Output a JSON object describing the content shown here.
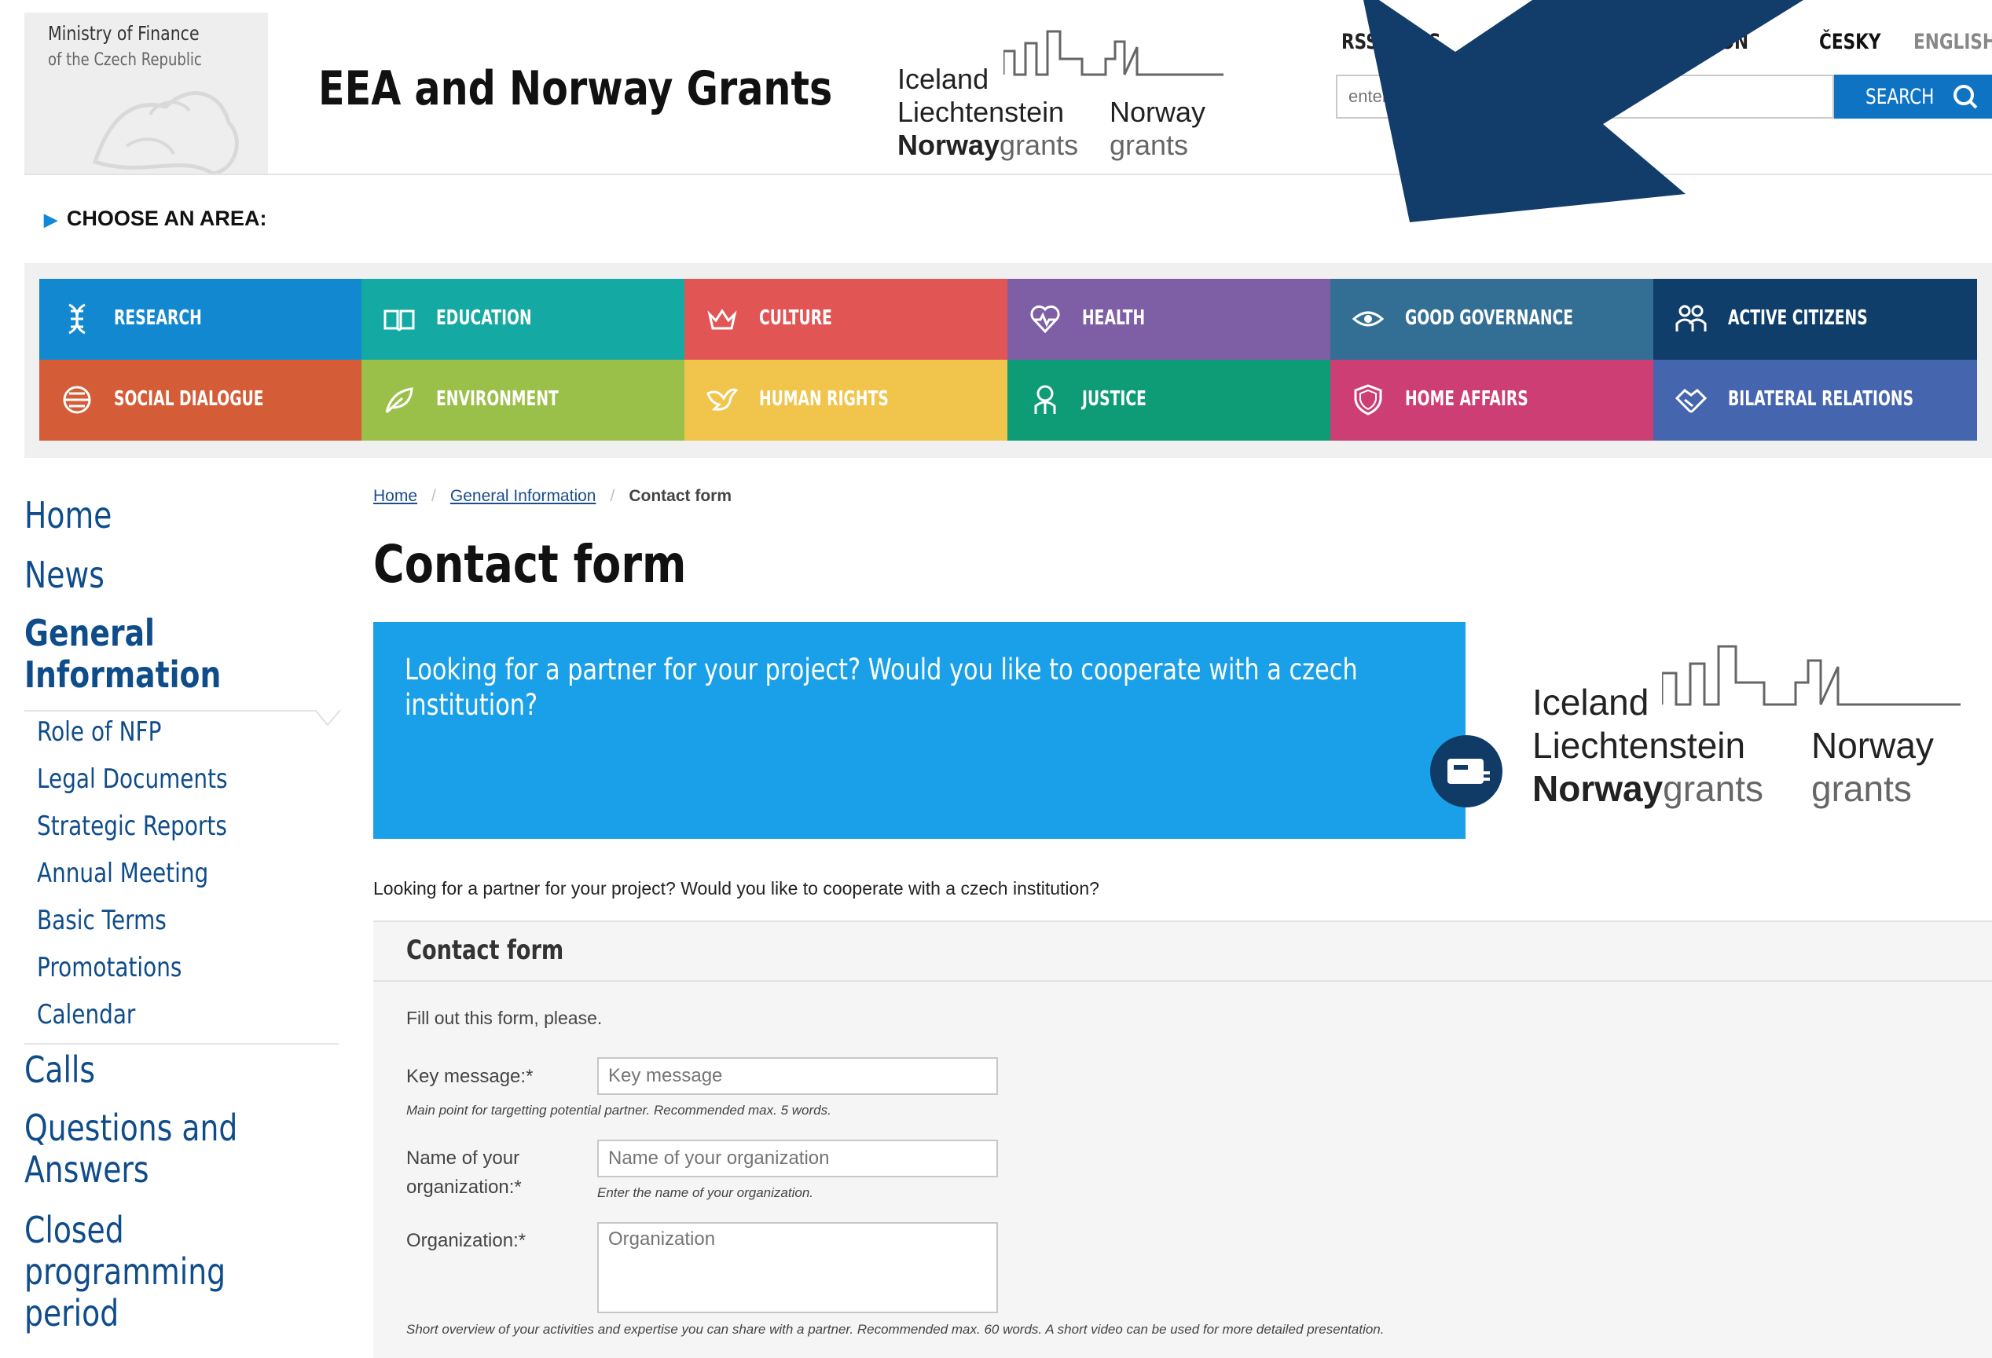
{
  "header": {
    "ministry_line1": "Ministry of Finance",
    "ministry_line2": "of the Czech Republic",
    "site_title": "EEA and Norway Grants",
    "logo_left": [
      "Iceland",
      "Liechtenstein",
      "Norway",
      "grants"
    ],
    "logo_right": [
      "Norway",
      "grants"
    ],
    "links": {
      "rss": "RSS NEWS",
      "version": "VERSION",
      "czech": "ČESKY",
      "english": "ENGLISH"
    },
    "search": {
      "placeholder": "enter text",
      "button_label": "SEARCH",
      "icon": "search-icon"
    }
  },
  "areas": {
    "label": "CHOOSE AN AREA:",
    "tiles": [
      {
        "label": "RESEARCH",
        "color": "#1188d0",
        "icon": "dna-icon"
      },
      {
        "label": "EDUCATION",
        "color": "#14a9a2",
        "icon": "book-icon"
      },
      {
        "label": "CULTURE",
        "color": "#e25555",
        "icon": "crown-icon"
      },
      {
        "label": "HEALTH",
        "color": "#7e5ea5",
        "icon": "heartbeat-icon"
      },
      {
        "label": "GOOD GOVERNANCE",
        "color": "#336e94",
        "icon": "eye-icon"
      },
      {
        "label": "ACTIVE CITIZENS",
        "color": "#103e6b",
        "icon": "people-icon"
      },
      {
        "label": "SOCIAL DIALOGUE",
        "color": "#d45c37",
        "icon": "dialogue-icon"
      },
      {
        "label": "ENVIRONMENT",
        "color": "#9bc04a",
        "icon": "leaf-icon"
      },
      {
        "label": "HUMAN RIGHTS",
        "color": "#f1c44c",
        "icon": "dove-icon"
      },
      {
        "label": "JUSTICE",
        "color": "#0d9c76",
        "icon": "justice-icon"
      },
      {
        "label": "HOME AFFAIRS",
        "color": "#cc3e74",
        "icon": "shield-icon"
      },
      {
        "label": "BILATERAL RELATIONS",
        "color": "#4566ae",
        "icon": "handshake-icon"
      }
    ]
  },
  "nav": {
    "main1": "Home",
    "main2": "News",
    "active_line1": "General",
    "active_line2": "Information",
    "sub": [
      "Role of NFP",
      "Legal Documents",
      "Strategic Reports",
      "Annual Meeting",
      "Basic Terms",
      "Promotations",
      "Calendar"
    ],
    "calls": "Calls",
    "qa_line1": "Questions and",
    "qa_line2": "Answers",
    "closed_line1": "Closed",
    "closed_line2": "programming",
    "closed_line3": "period"
  },
  "breadcrumb": {
    "home": "Home",
    "general": "General Information",
    "current": "Contact form"
  },
  "page_title": "Contact form",
  "banner": {
    "text": "Looking for a partner for your project? Would you like to cooperate with a czech institution?",
    "badge_icon": "id-card-icon"
  },
  "intro": "Looking for a partner for your project? Would you like to cooperate with a czech institution?",
  "form": {
    "heading": "Contact form",
    "intro": "Fill out this form, please.",
    "key_message": {
      "label": "Key message:*",
      "placeholder": "Key message",
      "help": "Main point for targetting potential partner. Recommended max. 5 words."
    },
    "org_name": {
      "label_line1": "Name of your",
      "label_line2": "organization:*",
      "placeholder": "Name of your organization",
      "help": "Enter the name of your organization."
    },
    "organization": {
      "label": "Organization:*",
      "placeholder": "Organization",
      "help": "Short overview of your activities and expertise you can share with a partner. Recommended max. 60 words. A short video can be used for more detailed presentation."
    }
  }
}
